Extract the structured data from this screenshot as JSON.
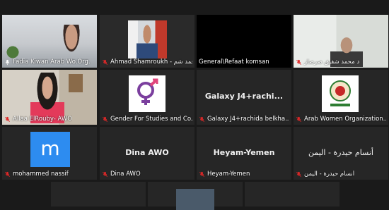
{
  "participants": [
    {
      "name": "Fadia Kiwan Arab Wo.Org.",
      "display": "",
      "muted": false,
      "active": true
    },
    {
      "name": "Ahmad Shamroukh - أحمد شم...",
      "display": "",
      "muted": true
    },
    {
      "name": "General\\Refaat komsan",
      "display": "",
      "muted": false
    },
    {
      "name": "د محمد شفيق صرصار",
      "display": "",
      "muted": true
    },
    {
      "name": "Allaa ElRouby- AWO",
      "display": "",
      "muted": true
    },
    {
      "name": "Gender For Studies and Co...",
      "display": "",
      "muted": true
    },
    {
      "name": "Galaxy J4+rachida belkha...",
      "display": "Galaxy  J4+rachi...",
      "muted": true
    },
    {
      "name": "Arab Women Organization...",
      "display": "",
      "muted": true
    },
    {
      "name": "mohammed nassif",
      "display": "m",
      "muted": true
    },
    {
      "name": "Dina AWO",
      "display": "Dina AWO",
      "muted": true
    },
    {
      "name": "Heyam-Yemen",
      "display": "Heyam-Yemen",
      "muted": true
    },
    {
      "name": "أنسام حيدرة - اليمن",
      "display": "أنسام حيدرة - اليمن",
      "muted": true
    }
  ],
  "colors": {
    "active_border": "#a6d64b",
    "muted_red": "#e02828",
    "avatar_blue": "#2d8cf0"
  }
}
